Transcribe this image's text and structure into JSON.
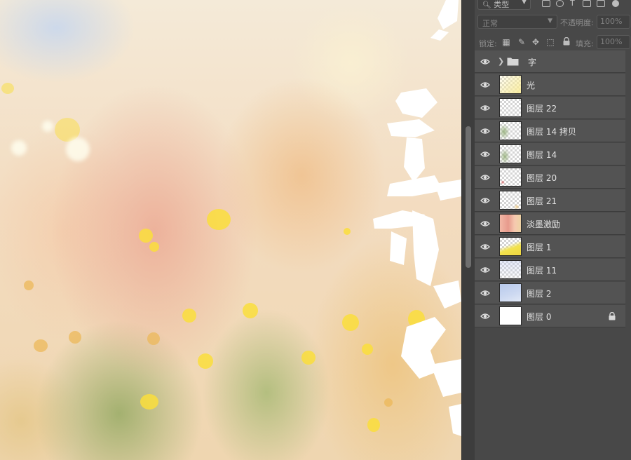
{
  "canvas": {
    "artwork": "watercolor-background",
    "calligraphy_color": "#ffffff"
  },
  "layers_panel": {
    "filter": {
      "value": "类型"
    },
    "blend_mode": {
      "value": "正常"
    },
    "opacity": {
      "label": "不透明度:",
      "value": "100%"
    },
    "lock": {
      "label": "锁定:"
    },
    "fill": {
      "label": "填充:",
      "value": "100%"
    },
    "layers": [
      {
        "name": "字",
        "type": "group",
        "visible": true,
        "thumbnail": "folder-icon"
      },
      {
        "name": "光",
        "visible": true,
        "thumbnail": "light-flare"
      },
      {
        "name": "图层 22",
        "visible": true,
        "thumbnail": "transparent"
      },
      {
        "name": "图层 14 拷贝",
        "visible": true,
        "thumbnail": "greenery"
      },
      {
        "name": "图层 14",
        "visible": true,
        "thumbnail": "greenery"
      },
      {
        "name": "图层 20",
        "visible": true,
        "thumbnail": "transparent"
      },
      {
        "name": "图层 21",
        "visible": true,
        "thumbnail": "transparent"
      },
      {
        "name": "淡墨激励",
        "visible": true,
        "thumbnail": "pink-ink"
      },
      {
        "name": "图层 1",
        "visible": true,
        "thumbnail": "yellow-wash"
      },
      {
        "name": "图层 11",
        "visible": true,
        "thumbnail": "transparent"
      },
      {
        "name": "图层 2",
        "visible": true,
        "thumbnail": "blue-wash"
      },
      {
        "name": "图层 0",
        "visible": true,
        "locked": true,
        "thumbnail": "white"
      }
    ]
  },
  "colors": {
    "panel_bg": "#484848",
    "row_bg": "#535353",
    "text": "#e2e2e2",
    "dim_text": "#8c8c8c"
  }
}
